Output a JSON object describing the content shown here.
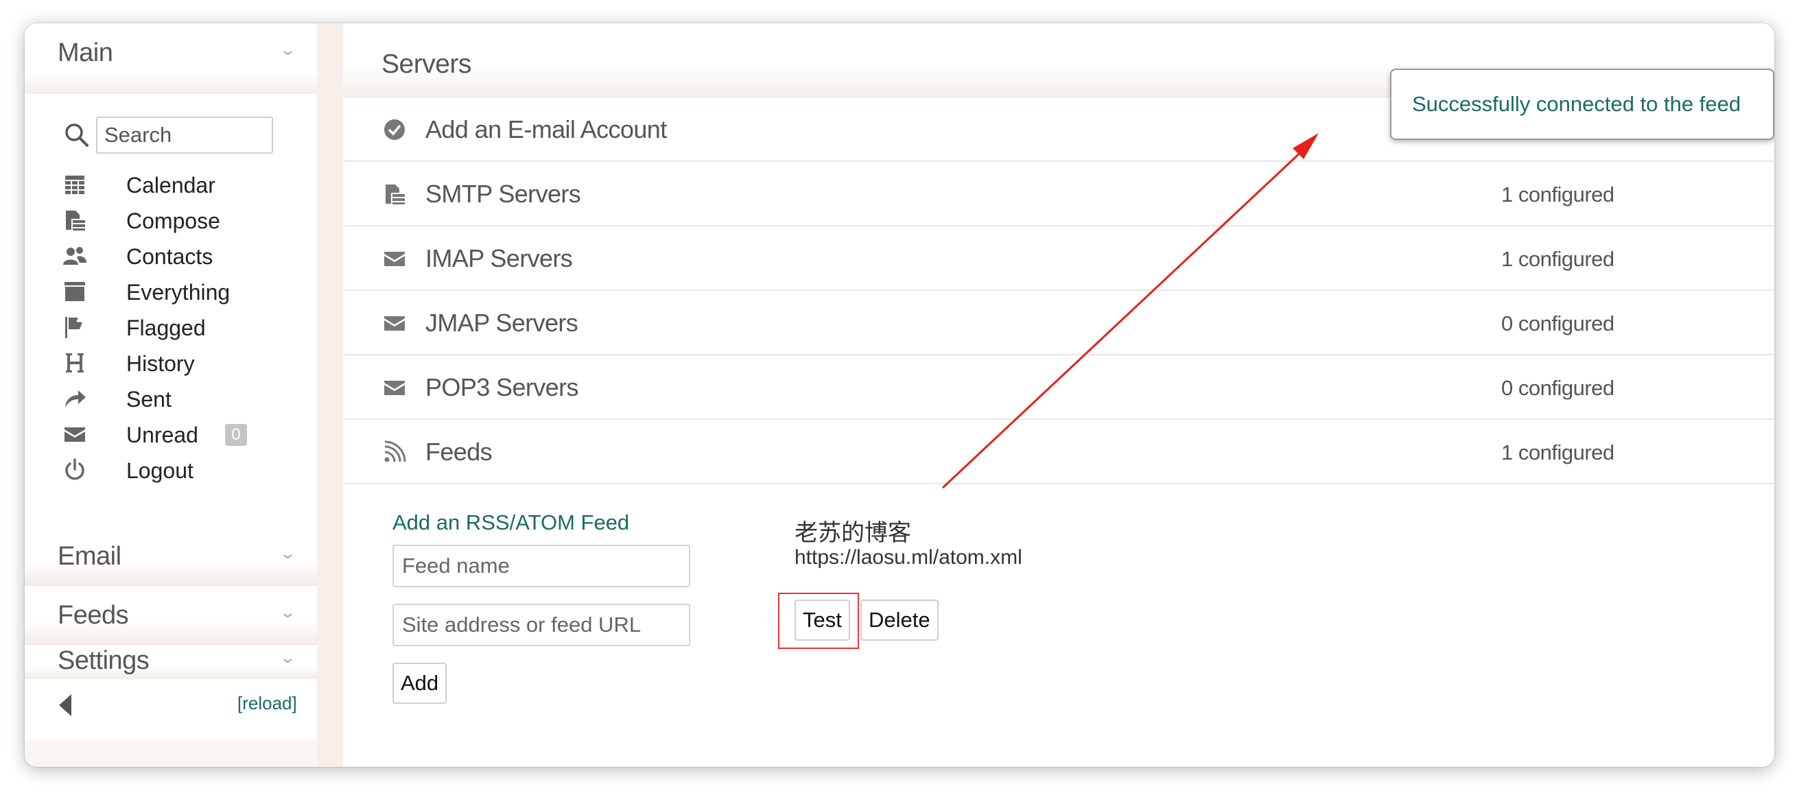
{
  "sidebar": {
    "main": {
      "title": "Main",
      "search_placeholder": "Search",
      "items": [
        {
          "label": "Calendar",
          "icon": "calendar-icon"
        },
        {
          "label": "Compose",
          "icon": "compose-icon"
        },
        {
          "label": "Contacts",
          "icon": "contacts-icon"
        },
        {
          "label": "Everything",
          "icon": "everything-icon"
        },
        {
          "label": "Flagged",
          "icon": "flag-icon"
        },
        {
          "label": "History",
          "icon": "history-icon"
        },
        {
          "label": "Sent",
          "icon": "sent-icon"
        },
        {
          "label": "Unread",
          "icon": "envelope-icon",
          "badge": "0"
        },
        {
          "label": "Logout",
          "icon": "power-icon"
        }
      ]
    },
    "sections": [
      {
        "title": "Email"
      },
      {
        "title": "Feeds"
      },
      {
        "title": "Settings"
      }
    ],
    "footer": {
      "reload_label": "[reload]"
    }
  },
  "content": {
    "title": "Servers",
    "rows": [
      {
        "label": "Add an E-mail Account",
        "status": "",
        "icon": "check-circle-icon"
      },
      {
        "label": "SMTP Servers",
        "status": "1 configured",
        "icon": "server-icon"
      },
      {
        "label": "IMAP Servers",
        "status": "1 configured",
        "icon": "envelope-icon"
      },
      {
        "label": "JMAP Servers",
        "status": "0 configured",
        "icon": "envelope-icon"
      },
      {
        "label": "POP3 Servers",
        "status": "0 configured",
        "icon": "envelope-icon"
      },
      {
        "label": "Feeds",
        "status": "1 configured",
        "icon": "rss-icon"
      }
    ],
    "add_feed": {
      "title": "Add an RSS/ATOM Feed",
      "name_placeholder": "Feed name",
      "url_placeholder": "Site address or feed URL",
      "add_label": "Add"
    },
    "feed": {
      "name": "老苏的博客",
      "url": "https://laosu.ml/atom.xml",
      "test_label": "Test",
      "delete_label": "Delete"
    }
  },
  "notification": {
    "text": "Successfully connected to the feed"
  },
  "colors": {
    "accent": "#1a6b64",
    "annotation": "#e8201a"
  }
}
